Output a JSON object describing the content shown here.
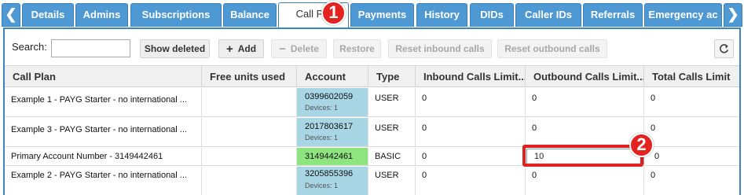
{
  "tabs": {
    "scroll_left": "❮",
    "scroll_right": "❯",
    "items": [
      "Details",
      "Admins",
      "Subscriptions",
      "Balance",
      "Call Pla",
      "Payments",
      "History",
      "DIDs",
      "Caller IDs",
      "Referrals",
      "Emergency ac"
    ],
    "active_index": 4
  },
  "toolbar": {
    "search_label": "Search:",
    "search_value": "",
    "show_deleted": "Show deleted",
    "add": "Add",
    "delete": "Delete",
    "restore": "Restore",
    "reset_inbound": "Reset inbound calls",
    "reset_outbound": "Reset outbound calls",
    "refresh_icon": "refresh-icon"
  },
  "columns": [
    "Call Plan",
    "Free units used",
    "Account",
    "Type",
    "Inbound Calls Limit...",
    "Outbound Calls Limit...",
    "Total Calls Limit"
  ],
  "rows": [
    {
      "plan": "Example 1 - PAYG Starter - no international ...",
      "free": "",
      "account": "0399602059",
      "devices": "Devices: 1",
      "type": "USER",
      "inbound": "0",
      "outbound": "0",
      "total": "0"
    },
    {
      "plan": "Example 3 - PAYG Starter - no international ...",
      "free": "",
      "account": "2017803617",
      "devices": "Devices: 1",
      "type": "USER",
      "inbound": "0",
      "outbound": "0",
      "total": "0"
    },
    {
      "plan": "Primary Account Number - 3149442461",
      "free": "",
      "account": "3149442461",
      "devices": "",
      "type": "BASIC",
      "inbound": "0",
      "outbound": "10",
      "total": "0"
    },
    {
      "plan": "Example 2 - PAYG Starter - no international ...",
      "free": "",
      "account": "3205855396",
      "devices": "Devices: 1",
      "type": "USER",
      "inbound": "0",
      "outbound": "0",
      "total": "0"
    }
  ],
  "callouts": [
    "1",
    "2"
  ],
  "colors": {
    "tab": "#4e99d3",
    "account_cell": "#a9d6e5",
    "basic_account_cell": "#8ee580",
    "callout": "#e4221f"
  }
}
